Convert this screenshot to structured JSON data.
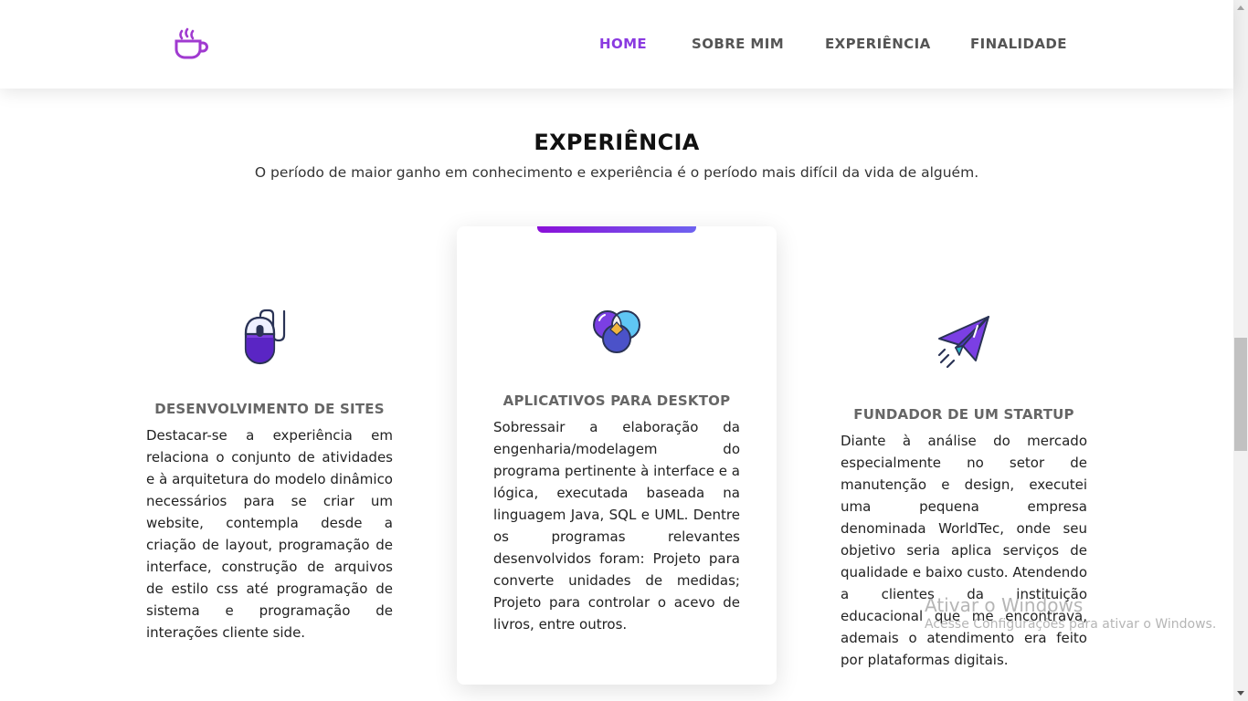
{
  "nav": {
    "logo_icon": "coffee-cup-icon",
    "items": [
      {
        "label": "HOME",
        "active": true
      },
      {
        "label": "SOBRE MIM",
        "active": false
      },
      {
        "label": "EXPERIÊNCIA",
        "active": false
      },
      {
        "label": "FINALIDADE",
        "active": false
      }
    ],
    "active_color": "#8a3ae0"
  },
  "section": {
    "title": "EXPERIÊNCIA",
    "subtitle": "O período de maior ganho em conhecimento e experiência é o período mais difícil da vida de alguém."
  },
  "cards": [
    {
      "icon": "mouse-icon",
      "title": "DESENVOLVIMENTO DE SITES",
      "text": "Destacar-se a experiência em relaciona o conjunto de atividades e à arquitetura do modelo dinâmico necessários para se criar um website, contempla desde a criação de layout, programação de interface, construção de arquivos de estilo css até programação de sistema e programação de interações cliente side."
    },
    {
      "icon": "venn-circles-icon",
      "title": "APLICATIVOS PARA DESKTOP",
      "text": "Sobressair a elaboração da engenharia/modelagem do programa pertinente à interface e a lógica, executada baseada na linguagem Java, SQL e UML. Dentre os programas relevantes desenvolvidos foram: Projeto para converte unidades de medidas; Projeto para controlar o acevo de livros, entre outros."
    },
    {
      "icon": "paper-plane-icon",
      "title": "FUNDADOR DE UM STARTUP",
      "text": "Diante à análise do mercado especialmente no setor de manutenção e design, executei uma pequena empresa denominada WorldTec, onde seu objetivo seria aplica serviços de qualidade e baixo custo. Atendendo a clientes da instituição educacional que me encontrava, ademais o atendimento era feito por plataformas digitais."
    }
  ],
  "colors": {
    "accent_purple": "#7b3fe4",
    "highlight_gradient_start": "#8a0fd8",
    "highlight_gradient_end": "#6e63f0"
  },
  "watermark": {
    "title": "Ativar o Windows",
    "subtitle": "Acesse Configurações para ativar o Windows."
  }
}
